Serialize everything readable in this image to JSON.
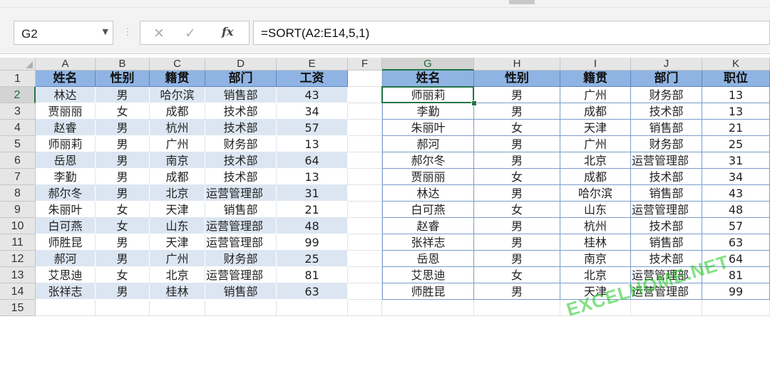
{
  "formula_bar": {
    "name_box": "G2",
    "cancel_glyph": "✕",
    "enter_glyph": "✓",
    "fx_label": "fx",
    "formula": "=SORT(A2:E14,5,1)"
  },
  "columns": [
    "A",
    "B",
    "C",
    "D",
    "E",
    "F",
    "G",
    "H",
    "I",
    "J",
    "K"
  ],
  "selected_column": "G",
  "rows": [
    "1",
    "2",
    "3",
    "4",
    "5",
    "6",
    "7",
    "8",
    "9",
    "10",
    "11",
    "12",
    "13",
    "14",
    "15"
  ],
  "selected_row": "2",
  "source_table": {
    "headers": [
      "姓名",
      "性别",
      "籍贯",
      "部门",
      "工资"
    ],
    "rows": [
      [
        "林达",
        "男",
        "哈尔滨",
        "销售部",
        "43"
      ],
      [
        "贾丽丽",
        "女",
        "成都",
        "技术部",
        "34"
      ],
      [
        "赵睿",
        "男",
        "杭州",
        "技术部",
        "57"
      ],
      [
        "师丽莉",
        "男",
        "广州",
        "财务部",
        "13"
      ],
      [
        "岳恩",
        "男",
        "南京",
        "技术部",
        "64"
      ],
      [
        "李勤",
        "男",
        "成都",
        "技术部",
        "13"
      ],
      [
        "郝尔冬",
        "男",
        "北京",
        "运营管理部",
        "31"
      ],
      [
        "朱丽叶",
        "女",
        "天津",
        "销售部",
        "21"
      ],
      [
        "白可燕",
        "女",
        "山东",
        "运营管理部",
        "48"
      ],
      [
        "师胜昆",
        "男",
        "天津",
        "运营管理部",
        "99"
      ],
      [
        "郝河",
        "男",
        "广州",
        "财务部",
        "25"
      ],
      [
        "艾思迪",
        "女",
        "北京",
        "运营管理部",
        "81"
      ],
      [
        "张祥志",
        "男",
        "桂林",
        "销售部",
        "63"
      ]
    ]
  },
  "result_table": {
    "headers": [
      "姓名",
      "性别",
      "籍贯",
      "部门",
      "职位"
    ],
    "rows": [
      [
        "师丽莉",
        "男",
        "广州",
        "财务部",
        "13"
      ],
      [
        "李勤",
        "男",
        "成都",
        "技术部",
        "13"
      ],
      [
        "朱丽叶",
        "女",
        "天津",
        "销售部",
        "21"
      ],
      [
        "郝河",
        "男",
        "广州",
        "财务部",
        "25"
      ],
      [
        "郝尔冬",
        "男",
        "北京",
        "运营管理部",
        "31"
      ],
      [
        "贾丽丽",
        "女",
        "成都",
        "技术部",
        "34"
      ],
      [
        "林达",
        "男",
        "哈尔滨",
        "销售部",
        "43"
      ],
      [
        "白可燕",
        "女",
        "山东",
        "运营管理部",
        "48"
      ],
      [
        "赵睿",
        "男",
        "杭州",
        "技术部",
        "57"
      ],
      [
        "张祥志",
        "男",
        "桂林",
        "销售部",
        "63"
      ],
      [
        "岳恩",
        "男",
        "南京",
        "技术部",
        "64"
      ],
      [
        "艾思迪",
        "女",
        "北京",
        "运营管理部",
        "81"
      ],
      [
        "师胜昆",
        "男",
        "天津",
        "运营管理部",
        "99"
      ]
    ]
  },
  "watermark": "EXCELHOME.NET",
  "colors": {
    "header_fill": "#8fb4e3",
    "band_fill": "#dce6f2",
    "selection": "#217346"
  }
}
